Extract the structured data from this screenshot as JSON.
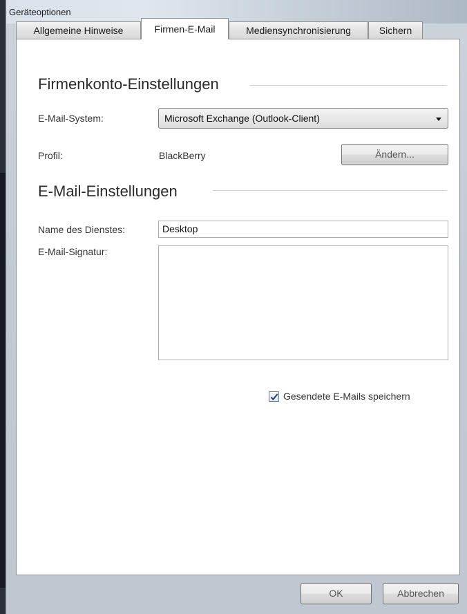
{
  "window": {
    "title": "Geräteoptionen"
  },
  "tabs": [
    {
      "label": "Allgemeine Hinweise",
      "active": false
    },
    {
      "label": "Firmen-E-Mail",
      "active": true
    },
    {
      "label": "Mediensynchronisierung",
      "active": false
    },
    {
      "label": "Sichern",
      "active": false
    }
  ],
  "company_section": {
    "title": "Firmenkonto-Einstellungen",
    "email_system_label": "E-Mail-System:",
    "email_system_value": "Microsoft Exchange (Outlook-Client)",
    "profile_label": "Profil:",
    "profile_value": "BlackBerry",
    "change_button": "Ändern..."
  },
  "email_section": {
    "title": "E-Mail-Einstellungen",
    "service_name_label": "Name des Dienstes:",
    "service_name_value": "Desktop",
    "signature_label": "E-Mail-Signatur:",
    "signature_value": "",
    "save_sent_label": "Gesendete E-Mails speichern",
    "save_sent_checked": true
  },
  "footer": {
    "ok": "OK",
    "cancel": "Abbrechen"
  },
  "icons": {
    "dropdown": "chevron-down-icon",
    "check": "checkmark-icon"
  }
}
